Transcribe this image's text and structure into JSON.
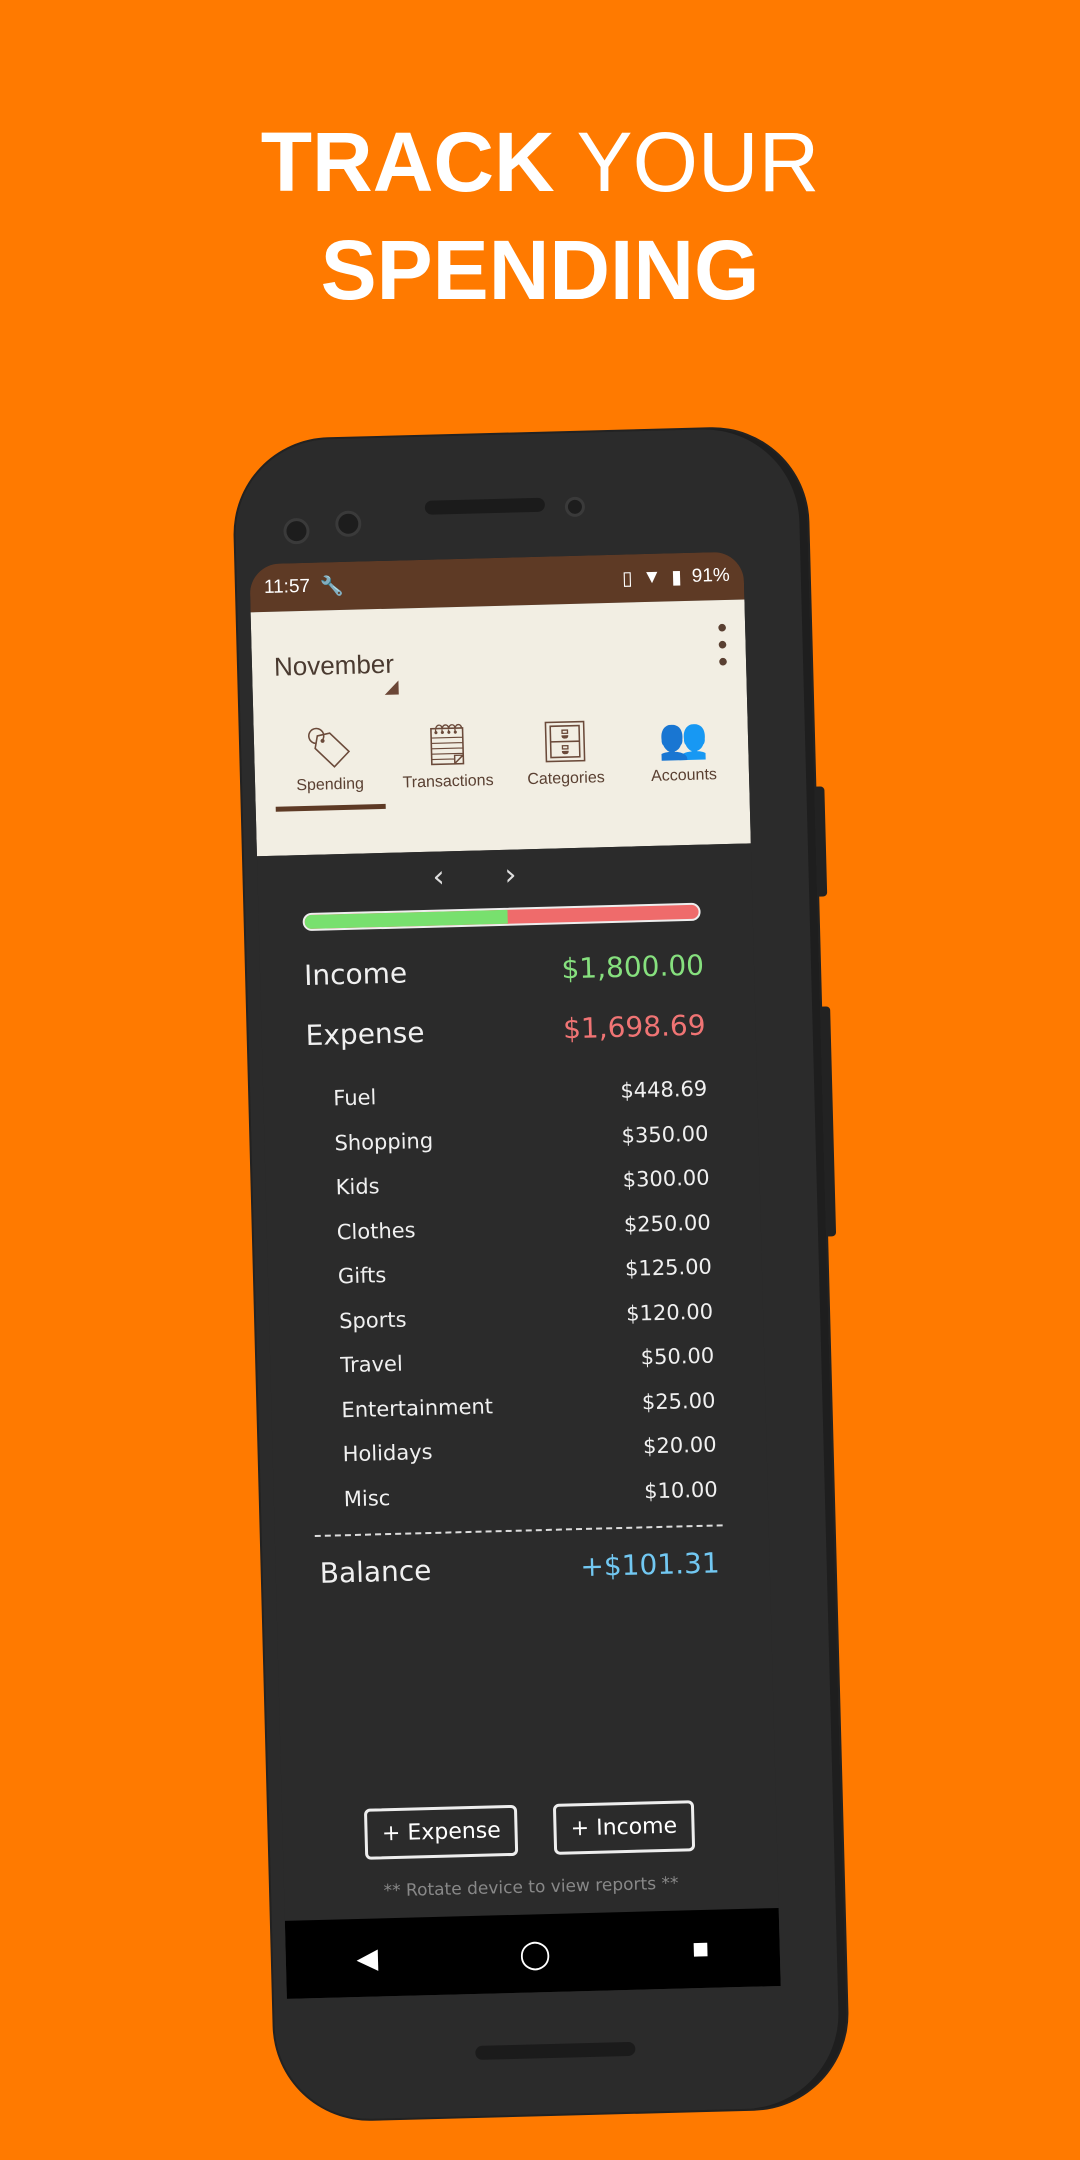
{
  "headline": {
    "bold1": "TRACK",
    "light": "YOUR",
    "line2": "SPENDING"
  },
  "status": {
    "time": "11:57",
    "battery": "91%"
  },
  "header": {
    "month": "November",
    "tabs": [
      {
        "label": "Spending",
        "icon": "price-tag-icon"
      },
      {
        "label": "Transactions",
        "icon": "notepad-icon"
      },
      {
        "label": "Categories",
        "icon": "file-cabinet-icon"
      },
      {
        "label": "Accounts",
        "icon": "people-icon"
      }
    ],
    "active_tab": "Spending"
  },
  "summary": {
    "income_label": "Income",
    "income": "$1,800.00",
    "expense_label": "Expense",
    "expense": "$1,698.69",
    "income_share_percent": 51.4,
    "categories": [
      {
        "name": "Fuel",
        "amount": "$448.69"
      },
      {
        "name": "Shopping",
        "amount": "$350.00"
      },
      {
        "name": "Kids",
        "amount": "$300.00"
      },
      {
        "name": "Clothes",
        "amount": "$250.00"
      },
      {
        "name": "Gifts",
        "amount": "$125.00"
      },
      {
        "name": "Sports",
        "amount": "$120.00"
      },
      {
        "name": "Travel",
        "amount": "$50.00"
      },
      {
        "name": "Entertainment",
        "amount": "$25.00"
      },
      {
        "name": "Holidays",
        "amount": "$20.00"
      },
      {
        "name": "Misc",
        "amount": "$10.00"
      }
    ],
    "balance_label": "Balance",
    "balance": "+$101.31"
  },
  "actions": {
    "add_expense": "+ Expense",
    "add_income": "+ Income",
    "hint": "** Rotate device to view reports **"
  },
  "colors": {
    "background": "#ff7a00",
    "status_bar": "#5e3a25",
    "income": "#86e07e",
    "expense": "#f07474",
    "balance": "#72c8f2"
  }
}
